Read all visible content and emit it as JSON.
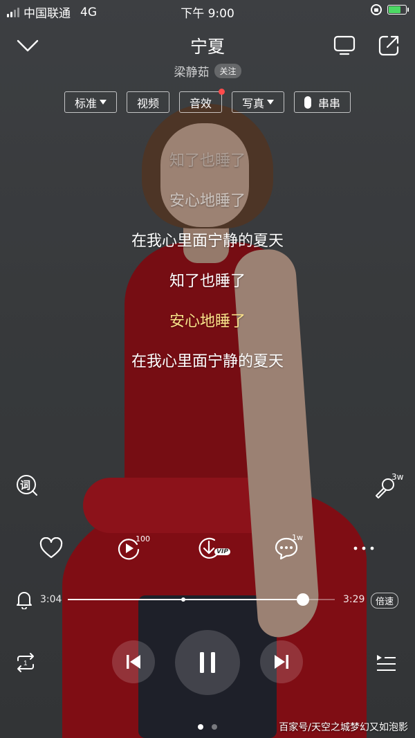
{
  "status_bar": {
    "carrier": "中国联通",
    "network": "4G",
    "time": "下午 9:00",
    "battery_level": 0.7
  },
  "header": {
    "back_icon": "chevron-down-icon",
    "title": "宁夏",
    "artist": "梁静茹",
    "follow_label": "关注",
    "right_icons": [
      "tv-cast-icon",
      "share-icon"
    ]
  },
  "pills": {
    "quality": "标准",
    "video": "视频",
    "effects": "音效",
    "photos": "写真",
    "chuanchuan": "串串"
  },
  "lyrics": [
    "知了也睡了",
    "安心地睡了",
    "在我心里面宁静的夏天",
    "知了也睡了",
    "安心地睡了",
    "在我心里面宁静的夏天"
  ],
  "current_lyric_index": 4,
  "side": {
    "lyrics_icon_label": "词",
    "sing_count": "3w"
  },
  "actions": {
    "play_count": "100",
    "download_badge": "VIP",
    "comment_count": "1w"
  },
  "progress": {
    "elapsed": "3:04",
    "total": "3:29",
    "fraction": 0.88,
    "speed_label": "倍速"
  },
  "player_state": "playing",
  "page_indicator": {
    "count": 2,
    "active": 0
  },
  "watermark": "百家号/天空之城梦幻又如泡影",
  "colors": {
    "current_lyric": "#fbe28a",
    "red_dot": "#ff4b4b",
    "battery_fill": "#4cd964"
  }
}
